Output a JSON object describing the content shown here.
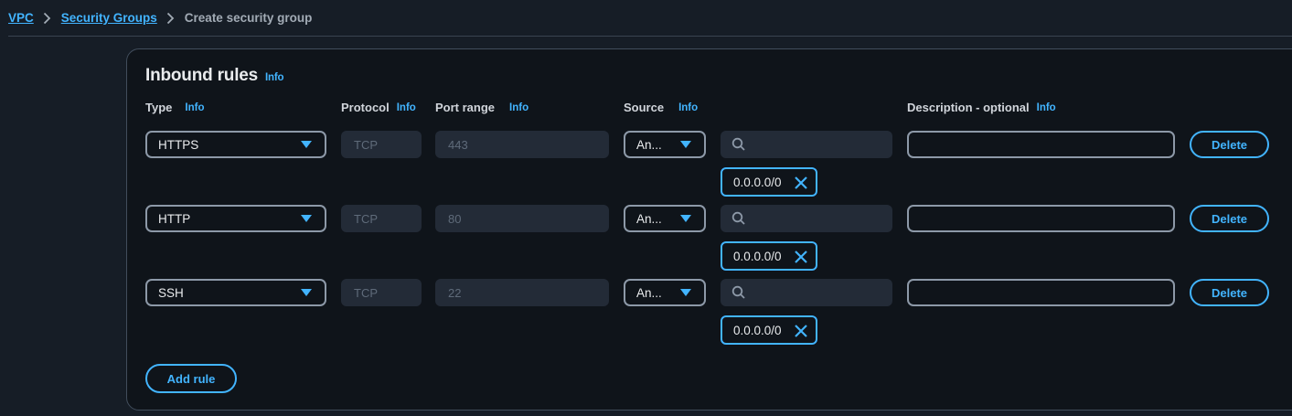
{
  "breadcrumb": {
    "items": [
      "VPC",
      "Security Groups"
    ],
    "current": "Create security group"
  },
  "panel": {
    "title": "Inbound rules",
    "info_label": "Info"
  },
  "columns": {
    "type": "Type",
    "protocol": "Protocol",
    "port_range": "Port range",
    "source": "Source",
    "description": "Description - optional"
  },
  "rules": [
    {
      "type": "HTTPS",
      "protocol": "TCP",
      "port": "443",
      "source": "An...",
      "cidr": "0.0.0.0/0",
      "description": "",
      "delete_label": "Delete"
    },
    {
      "type": "HTTP",
      "protocol": "TCP",
      "port": "80",
      "source": "An...",
      "cidr": "0.0.0.0/0",
      "description": "",
      "delete_label": "Delete"
    },
    {
      "type": "SSH",
      "protocol": "TCP",
      "port": "22",
      "source": "An...",
      "cidr": "0.0.0.0/0",
      "description": "",
      "delete_label": "Delete"
    }
  ],
  "add_rule_label": "Add rule",
  "colors": {
    "accent": "#42b4ff",
    "background": "#161d26",
    "panel": "#0f141a",
    "field_disabled": "#232b37"
  },
  "icons": {
    "breadcrumb_separator": "chevron-right-icon",
    "search": "search-icon",
    "remove_token": "close-icon",
    "dropdown": "caret-down-icon"
  }
}
